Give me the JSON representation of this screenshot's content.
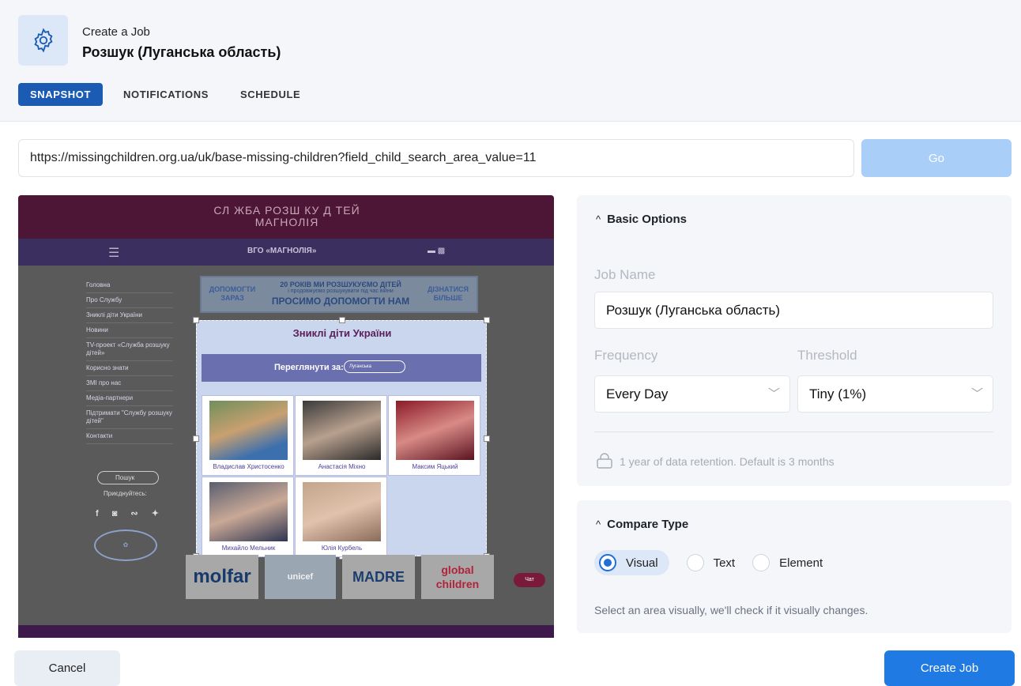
{
  "header": {
    "subtitle": "Create a Job",
    "title": "Розшук (Луганська область)",
    "tabs": [
      {
        "label": "SNAPSHOT",
        "active": true
      },
      {
        "label": "NOTIFICATIONS",
        "active": false
      },
      {
        "label": "SCHEDULE",
        "active": false
      }
    ]
  },
  "url_bar": {
    "value": "https://missingchildren.org.ua/uk/base-missing-children?field_child_search_area_value=11",
    "go_label": "Go"
  },
  "snapshot": {
    "logo_text": "СЛ ЖБА РОЗШ КУ Д ТЕЙ МАГНОЛІЯ",
    "nav_title": "ВГО «МАГНОЛІЯ»",
    "side_menu": [
      "Головна",
      "Про Службу",
      "Зниклі діти України",
      "Новини",
      "TV-проект «Служба розшуку дітей»",
      "Корисно знати",
      "ЗМІ про нас",
      "Медіа-партнери",
      "Підтримати \"Службу розшуку дітей\"",
      "Контакти"
    ],
    "search_label": "Пошук",
    "join_label": "Приєднуйтесь:",
    "banner": {
      "left": "ДОПОМОГТИ ЗАРАЗ",
      "mid_a": "20 РОКІВ МИ РОЗШУКУЄМО ДІТЕЙ",
      "mid_b": "і продовжуємо розшукувати під час війни",
      "mid_c": "ПРОСИМО ДОПОМОГТИ НАМ",
      "right": "ДІЗНАТИСЯ БІЛЬШЕ"
    },
    "section_title": "Зниклі діти України",
    "filter_label": "Переглянути за:",
    "filter_value": "Луганська",
    "children": [
      {
        "name": "Владислав Христосенко"
      },
      {
        "name": "Анастасія Міхно"
      },
      {
        "name": "Максим Яцький"
      },
      {
        "name": "Михайло Мельник"
      },
      {
        "name": "Юлія Курбель"
      }
    ],
    "sponsors": [
      "molfar",
      "unicef",
      "MADRE",
      "global children"
    ],
    "chat_label": "Чат"
  },
  "basic_options": {
    "heading": "Basic Options",
    "job_name_label": "Job Name",
    "job_name_value": "Розшук (Луганська область)",
    "frequency_label": "Frequency",
    "frequency_value": "Every Day",
    "threshold_label": "Threshold",
    "threshold_value": "Tiny (1%)",
    "retention_note": "1 year of data retention. Default is 3 months"
  },
  "compare_type": {
    "heading": "Compare Type",
    "options": [
      {
        "label": "Visual",
        "selected": true
      },
      {
        "label": "Text",
        "selected": false
      },
      {
        "label": "Element",
        "selected": false
      }
    ],
    "help": "Select an area visually, we'll check if it visually changes."
  },
  "footer": {
    "cancel_label": "Cancel",
    "create_label": "Create Job"
  },
  "colors": {
    "primary": "#1f7ae3",
    "tab_active": "#1c5bb4",
    "go_disabled": "#a9cef7"
  }
}
